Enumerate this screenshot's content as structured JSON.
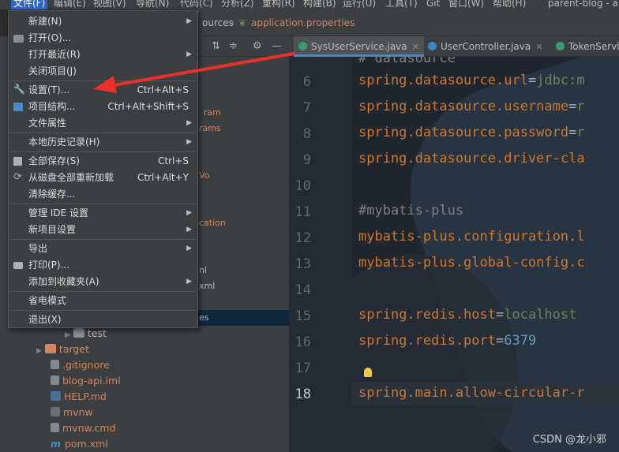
{
  "menubar": {
    "items": [
      {
        "label": "文件(F)"
      },
      {
        "label": "编辑(E)"
      },
      {
        "label": "视图(V)"
      },
      {
        "label": "导航(N)"
      },
      {
        "label": "代码(C)"
      },
      {
        "label": "分析(Z)"
      },
      {
        "label": "重构(R)"
      },
      {
        "label": "构建(B)"
      },
      {
        "label": "运行(U)"
      },
      {
        "label": "工具(T)"
      },
      {
        "label": "Git"
      },
      {
        "label": "窗口(W)"
      },
      {
        "label": "帮助(H)"
      }
    ],
    "window_title": "parent-blog - a"
  },
  "breadcrumb": {
    "folder": "ources",
    "file": "application.properties"
  },
  "file_menu": {
    "items": [
      {
        "label": "新建(N)",
        "shortcut": "",
        "submenu": true
      },
      {
        "label": "打开(O)...",
        "shortcut": "",
        "submenu": false
      },
      {
        "label": "打开最近(R)",
        "shortcut": "",
        "submenu": true
      },
      {
        "label": "关闭项目(J)",
        "shortcut": "",
        "submenu": false
      },
      {
        "label": "设置(T)...",
        "shortcut": "Ctrl+Alt+S",
        "submenu": false
      },
      {
        "label": "项目结构...",
        "shortcut": "Ctrl+Alt+Shift+S",
        "submenu": false
      },
      {
        "label": "文件属性",
        "shortcut": "",
        "submenu": true
      },
      {
        "label": "本地历史记录(H)",
        "shortcut": "",
        "submenu": true
      },
      {
        "label": "全部保存(S)",
        "shortcut": "Ctrl+S",
        "submenu": false
      },
      {
        "label": "从磁盘全部重新加载",
        "shortcut": "Ctrl+Alt+Y",
        "submenu": false
      },
      {
        "label": "清除缓存...",
        "shortcut": "",
        "submenu": false
      },
      {
        "label": "管理 IDE 设置",
        "shortcut": "",
        "submenu": true
      },
      {
        "label": "新项目设置",
        "shortcut": "",
        "submenu": true
      },
      {
        "label": "导出",
        "shortcut": "",
        "submenu": true
      },
      {
        "label": "打印(P)...",
        "shortcut": "",
        "submenu": false
      },
      {
        "label": "添加到收藏夹(A)",
        "shortcut": "",
        "submenu": true
      },
      {
        "label": "省电模式",
        "shortcut": "",
        "submenu": false
      },
      {
        "label": "退出(X)",
        "shortcut": "",
        "submenu": false
      }
    ]
  },
  "project_tree": {
    "fragments": [
      "ram",
      "rams",
      "Vo",
      "cation",
      "nl",
      "xml",
      "es"
    ],
    "items": [
      {
        "name": "test",
        "icon": "folder-icon",
        "color": "#bbbbbb"
      },
      {
        "name": "target",
        "icon": "folder-icon",
        "color": "#d08660"
      },
      {
        "name": ".gitignore",
        "icon": "file-icon",
        "color": "#d08660"
      },
      {
        "name": "blog-api.iml",
        "icon": "file-icon",
        "color": "#d08660"
      },
      {
        "name": "HELP.md",
        "icon": "markdown-icon",
        "color": "#d08660"
      },
      {
        "name": "mvnw",
        "icon": "terminal-icon",
        "color": "#d08660"
      },
      {
        "name": "mvnw.cmd",
        "icon": "file-icon",
        "color": "#d08660"
      },
      {
        "name": "pom.xml",
        "icon": "maven-icon",
        "color": "#d08660"
      }
    ]
  },
  "tabs": [
    {
      "label": "SysUserService.java",
      "icon": "java-class-icon",
      "active": true
    },
    {
      "label": "UserController.java",
      "icon": "java-class-icon",
      "active": false
    },
    {
      "label": "TokenServic",
      "icon": "java-class-icon",
      "active": false
    }
  ],
  "editor": {
    "lines": [
      {
        "n": "6",
        "key": "spring.datasource.url",
        "val": "jdbc:m"
      },
      {
        "n": "7",
        "key": "spring.datasource.username",
        "val": "r"
      },
      {
        "n": "8",
        "key": "spring.datasource.password",
        "val": "r"
      },
      {
        "n": "9",
        "key": "spring.datasource.driver-cla",
        "val": ""
      },
      {
        "n": "10",
        "comment": ""
      },
      {
        "n": "11",
        "comment": "#mybatis-plus"
      },
      {
        "n": "12",
        "key": "mybatis-plus.configuration.l",
        "val": ""
      },
      {
        "n": "13",
        "key": "mybatis-plus.global-config.c",
        "val": ""
      },
      {
        "n": "14",
        "comment": ""
      },
      {
        "n": "15",
        "key": "spring.redis.host",
        "val": "localhost"
      },
      {
        "n": "16",
        "key": "spring.redis.port",
        "val": "6379"
      },
      {
        "n": "17",
        "comment": ""
      },
      {
        "n": "18",
        "key": "spring.main.allow-circular-r",
        "val": ""
      }
    ],
    "top_partial": "# datasource"
  },
  "watermark": "CSDN @龙小邪",
  "colors": {
    "menu_bg": "#3c3f41",
    "editor_bg": "#20262d",
    "key": "#cc7832",
    "value": "#6a8759",
    "arrow": "#e8312b",
    "tab_underline": "#4a88c7"
  }
}
